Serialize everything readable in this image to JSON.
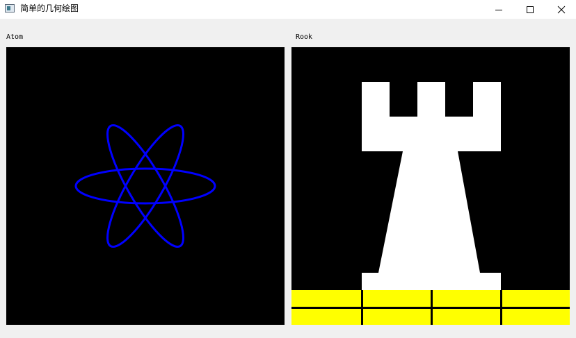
{
  "window": {
    "title": "简单的几何绘图",
    "controls": [
      "minimize",
      "maximize",
      "close"
    ]
  },
  "panels": {
    "left": {
      "label": "Atom",
      "background": "#000000",
      "orbit_color": "#0000ff",
      "orbit_angles_deg": [
        0,
        60,
        120
      ],
      "orbit_count": 3
    },
    "right": {
      "label": "Rook",
      "background": "#000000",
      "piece_color": "#ffffff",
      "base_color": "#ffff00",
      "base_grid_color": "#000000"
    }
  }
}
